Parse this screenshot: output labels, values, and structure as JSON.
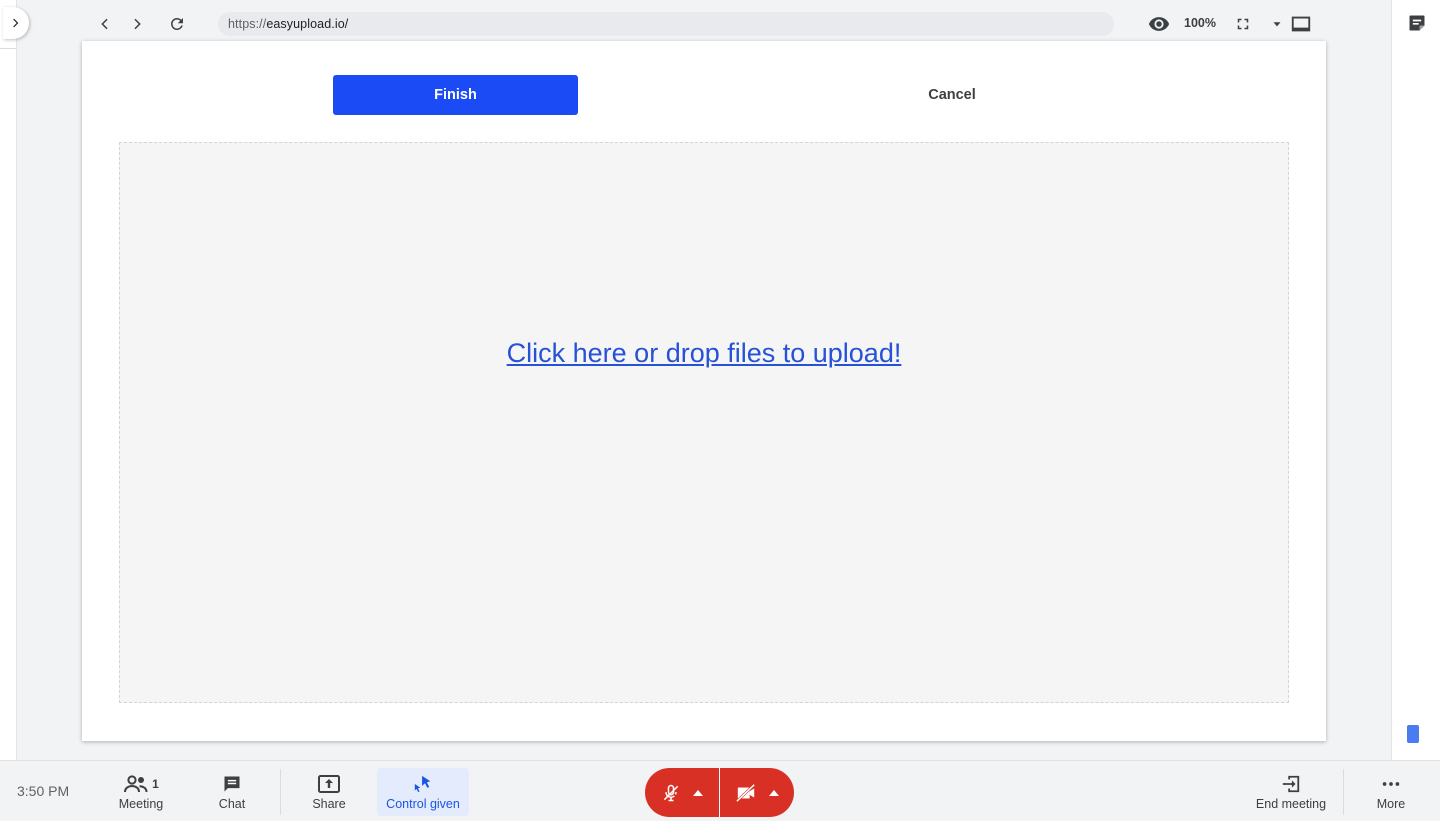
{
  "browser": {
    "url_prefix": "https://",
    "url_host": "easyupload.io/",
    "zoom": "100%"
  },
  "page": {
    "finish_label": "Finish",
    "cancel_label": "Cancel",
    "dropzone_text": "Click here or drop files to upload!"
  },
  "toolbar": {
    "time": "3:50 PM",
    "meeting_label": "Meeting",
    "participant_count": "1",
    "chat_label": "Chat",
    "share_label": "Share",
    "control_label": "Control given",
    "end_meeting_label": "End meeting",
    "more_label": "More"
  },
  "colors": {
    "primary_button": "#1a4bf5",
    "link": "#2652d8",
    "media_red": "#d93025",
    "control_active_bg": "#e3ebfd"
  },
  "icons": [
    "chevron-right-icon",
    "back-icon",
    "forward-icon",
    "reload-icon",
    "eye-icon",
    "fullscreen-icon",
    "dropdown-icon",
    "screen-icon",
    "notes-icon",
    "people-icon",
    "chat-icon",
    "share-screen-icon",
    "control-cursor-icon",
    "mic-off-icon",
    "caret-up-icon",
    "camera-off-icon",
    "exit-icon",
    "more-dots-icon"
  ]
}
